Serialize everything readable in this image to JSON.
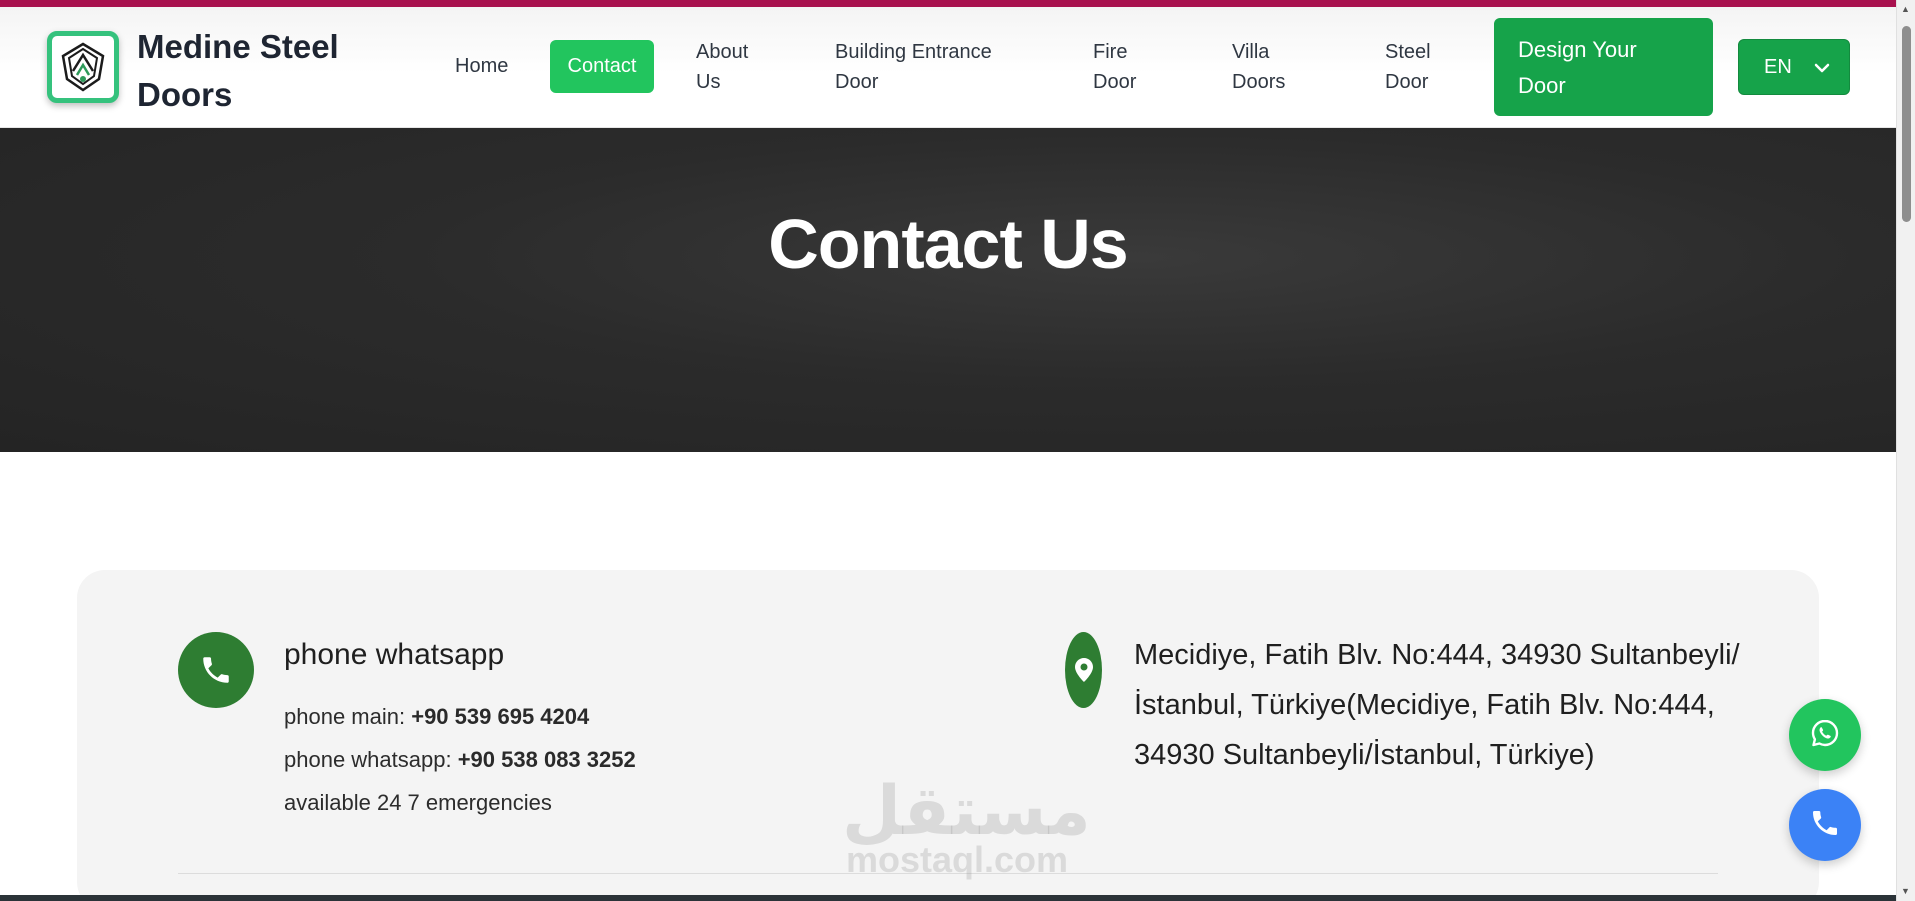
{
  "brand": {
    "name": "Medine Steel Doors"
  },
  "nav": {
    "home": "Home",
    "contact": "Contact",
    "about": "About Us",
    "building": "Building Entrance Door",
    "fire": "Fire Door",
    "villa": "Villa Doors",
    "steel": "Steel Door"
  },
  "cta": {
    "design_label": "Design Your Door"
  },
  "language": {
    "selected": "EN"
  },
  "hero": {
    "title": "Contact Us"
  },
  "contact": {
    "phone_title": "phone whatsapp",
    "phone_main_label": "phone main:",
    "phone_main_value": "+90 539 695 4204",
    "phone_whatsapp_label": "phone whatsapp:",
    "phone_whatsapp_value": "+90 538 083 3252",
    "availability": "available 24 7 emergencies",
    "address": "Mecidiye, Fatih Blv. No:444, 34930 Sultanbeyli/İstanbul, Türkiye(Mecidiye, Fatih Blv. No:444, 34930 Sultanbeyli/İstanbul, Türkiye)"
  },
  "watermark": {
    "arabic": "مستقل",
    "latin": "mostaql.com"
  },
  "colors": {
    "accent_green": "#16a34a",
    "active_green": "#22c55e",
    "icon_green": "#2e7d32",
    "call_blue": "#3b82f6",
    "top_strip": "#a8114e"
  },
  "icons": {
    "phone": "phone-icon",
    "location": "location-pin-icon",
    "whatsapp": "whatsapp-icon",
    "call": "call-icon",
    "chevron": "chevron-down-icon",
    "logo": "logo-icon"
  }
}
